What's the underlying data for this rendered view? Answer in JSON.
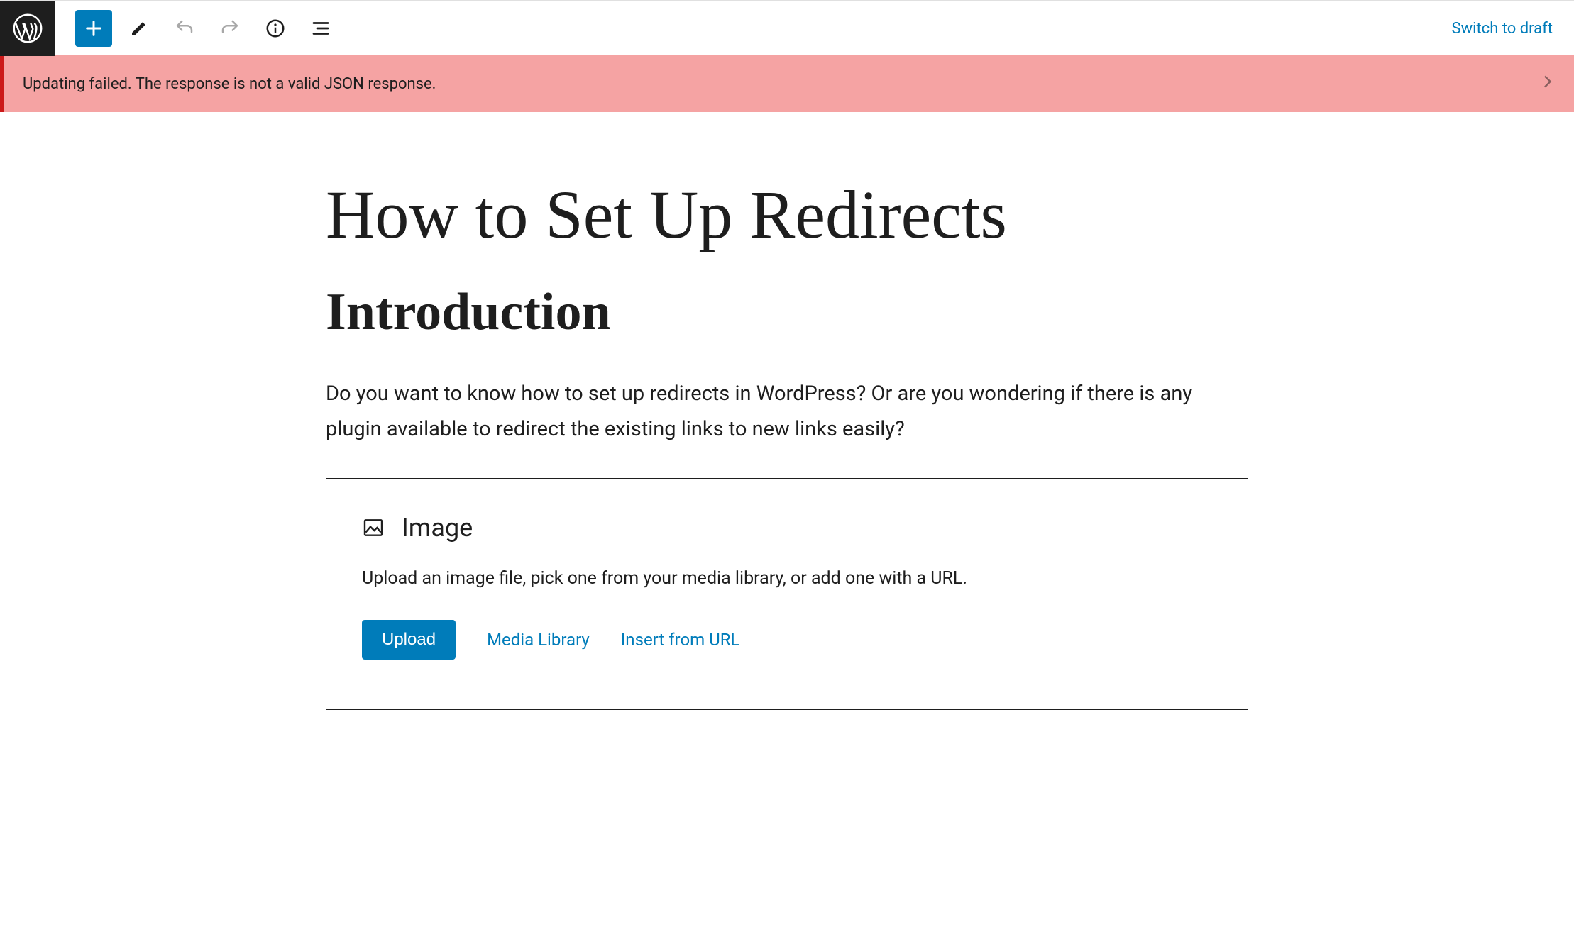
{
  "topbar": {
    "switch_draft": "Switch to draft"
  },
  "error": {
    "message": "Updating failed. The response is not a valid JSON response."
  },
  "post": {
    "title": "How to Set Up Redirects",
    "heading": "Introduction",
    "paragraph": "Do you want to know how to set up redirects in WordPress?  Or are you wondering if there is any plugin available to redirect the existing links to new links easily?"
  },
  "image_block": {
    "title": "Image",
    "description": "Upload an image file, pick one from your media library, or add one with a URL.",
    "upload": "Upload",
    "media_library": "Media Library",
    "insert_url": "Insert from URL"
  }
}
